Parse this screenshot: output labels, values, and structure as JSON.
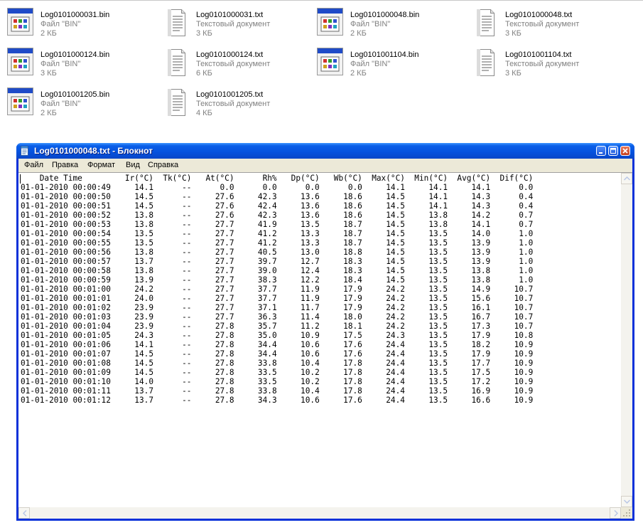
{
  "explorer": {
    "files": [
      {
        "name": "Log0101000031.bin",
        "type": "Файл \"BIN\"",
        "size": "2 КБ",
        "icon": "bin-file-icon"
      },
      {
        "name": "Log0101000031.txt",
        "type": "Текстовый документ",
        "size": "3 КБ",
        "icon": "text-document-icon"
      },
      {
        "name": "Log0101000048.bin",
        "type": "Файл \"BIN\"",
        "size": "2 КБ",
        "icon": "bin-file-icon"
      },
      {
        "name": "Log0101000048.txt",
        "type": "Текстовый документ",
        "size": "3 КБ",
        "icon": "text-document-icon"
      },
      {
        "name": "Log0101000124.bin",
        "type": "Файл \"BIN\"",
        "size": "3 КБ",
        "icon": "bin-file-icon"
      },
      {
        "name": "Log0101000124.txt",
        "type": "Текстовый документ",
        "size": "6 КБ",
        "icon": "text-document-icon"
      },
      {
        "name": "Log0101001104.bin",
        "type": "Файл \"BIN\"",
        "size": "2 КБ",
        "icon": "bin-file-icon"
      },
      {
        "name": "Log0101001104.txt",
        "type": "Текстовый документ",
        "size": "3 КБ",
        "icon": "text-document-icon"
      },
      {
        "name": "Log0101001205.bin",
        "type": "Файл \"BIN\"",
        "size": "2 КБ",
        "icon": "bin-file-icon"
      },
      {
        "name": "Log0101001205.txt",
        "type": "Текстовый документ",
        "size": "4 КБ",
        "icon": "text-document-icon"
      }
    ]
  },
  "notepad": {
    "title": "Log0101000048.txt - Блокнот",
    "menu": [
      "Файл",
      "Правка",
      "Формат",
      "Вид",
      "Справка"
    ],
    "columns": [
      "Date Time",
      "Ir(°C)",
      "Tk(°C)",
      "At(°C)",
      "Rh%",
      "Dp(°C)",
      "Wb(°C)",
      "Max(°C)",
      "Min(°C)",
      "Avg(°C)",
      "Dif(°C)"
    ],
    "rows": [
      [
        "01-01-2010 00:00:49",
        "14.1",
        "--",
        "0.0",
        "0.0",
        "0.0",
        "0.0",
        "14.1",
        "14.1",
        "14.1",
        "0.0"
      ],
      [
        "01-01-2010 00:00:50",
        "14.5",
        "--",
        "27.6",
        "42.3",
        "13.6",
        "18.6",
        "14.5",
        "14.1",
        "14.3",
        "0.4"
      ],
      [
        "01-01-2010 00:00:51",
        "14.5",
        "--",
        "27.6",
        "42.4",
        "13.6",
        "18.6",
        "14.5",
        "14.1",
        "14.3",
        "0.4"
      ],
      [
        "01-01-2010 00:00:52",
        "13.8",
        "--",
        "27.6",
        "42.3",
        "13.6",
        "18.6",
        "14.5",
        "13.8",
        "14.2",
        "0.7"
      ],
      [
        "01-01-2010 00:00:53",
        "13.8",
        "--",
        "27.7",
        "41.9",
        "13.5",
        "18.7",
        "14.5",
        "13.8",
        "14.1",
        "0.7"
      ],
      [
        "01-01-2010 00:00:54",
        "13.5",
        "--",
        "27.7",
        "41.2",
        "13.3",
        "18.7",
        "14.5",
        "13.5",
        "14.0",
        "1.0"
      ],
      [
        "01-01-2010 00:00:55",
        "13.5",
        "--",
        "27.7",
        "41.2",
        "13.3",
        "18.7",
        "14.5",
        "13.5",
        "13.9",
        "1.0"
      ],
      [
        "01-01-2010 00:00:56",
        "13.8",
        "--",
        "27.7",
        "40.5",
        "13.0",
        "18.8",
        "14.5",
        "13.5",
        "13.9",
        "1.0"
      ],
      [
        "01-01-2010 00:00:57",
        "13.7",
        "--",
        "27.7",
        "39.7",
        "12.7",
        "18.3",
        "14.5",
        "13.5",
        "13.9",
        "1.0"
      ],
      [
        "01-01-2010 00:00:58",
        "13.8",
        "--",
        "27.7",
        "39.0",
        "12.4",
        "18.3",
        "14.5",
        "13.5",
        "13.8",
        "1.0"
      ],
      [
        "01-01-2010 00:00:59",
        "13.9",
        "--",
        "27.7",
        "38.3",
        "12.2",
        "18.4",
        "14.5",
        "13.5",
        "13.8",
        "1.0"
      ],
      [
        "01-01-2010 00:01:00",
        "24.2",
        "--",
        "27.7",
        "37.7",
        "11.9",
        "17.9",
        "24.2",
        "13.5",
        "14.9",
        "10.7"
      ],
      [
        "01-01-2010 00:01:01",
        "24.0",
        "--",
        "27.7",
        "37.7",
        "11.9",
        "17.9",
        "24.2",
        "13.5",
        "15.6",
        "10.7"
      ],
      [
        "01-01-2010 00:01:02",
        "23.9",
        "--",
        "27.7",
        "37.1",
        "11.7",
        "17.9",
        "24.2",
        "13.5",
        "16.1",
        "10.7"
      ],
      [
        "01-01-2010 00:01:03",
        "23.9",
        "--",
        "27.7",
        "36.3",
        "11.4",
        "18.0",
        "24.2",
        "13.5",
        "16.7",
        "10.7"
      ],
      [
        "01-01-2010 00:01:04",
        "23.9",
        "--",
        "27.8",
        "35.7",
        "11.2",
        "18.1",
        "24.2",
        "13.5",
        "17.3",
        "10.7"
      ],
      [
        "01-01-2010 00:01:05",
        "24.3",
        "--",
        "27.8",
        "35.0",
        "10.9",
        "17.5",
        "24.3",
        "13.5",
        "17.9",
        "10.8"
      ],
      [
        "01-01-2010 00:01:06",
        "14.1",
        "--",
        "27.8",
        "34.4",
        "10.6",
        "17.6",
        "24.4",
        "13.5",
        "18.2",
        "10.9"
      ],
      [
        "01-01-2010 00:01:07",
        "14.5",
        "--",
        "27.8",
        "34.4",
        "10.6",
        "17.6",
        "24.4",
        "13.5",
        "17.9",
        "10.9"
      ],
      [
        "01-01-2010 00:01:08",
        "14.5",
        "--",
        "27.8",
        "33.8",
        "10.4",
        "17.8",
        "24.4",
        "13.5",
        "17.7",
        "10.9"
      ],
      [
        "01-01-2010 00:01:09",
        "14.5",
        "--",
        "27.8",
        "33.5",
        "10.2",
        "17.8",
        "24.4",
        "13.5",
        "17.5",
        "10.9"
      ],
      [
        "01-01-2010 00:01:10",
        "14.0",
        "--",
        "27.8",
        "33.5",
        "10.2",
        "17.8",
        "24.4",
        "13.5",
        "17.2",
        "10.9"
      ],
      [
        "01-01-2010 00:01:11",
        "13.7",
        "--",
        "27.8",
        "33.8",
        "10.4",
        "17.8",
        "24.4",
        "13.5",
        "16.9",
        "10.9"
      ],
      [
        "01-01-2010 00:01:12",
        "13.7",
        "--",
        "27.8",
        "34.3",
        "10.6",
        "17.6",
        "24.4",
        "13.5",
        "16.6",
        "10.9"
      ]
    ]
  },
  "colors": {
    "titlebar": "#0551dd",
    "window_frame": "#0831d9",
    "menubar": "#ece9d8",
    "secondary_text": "#808080"
  }
}
